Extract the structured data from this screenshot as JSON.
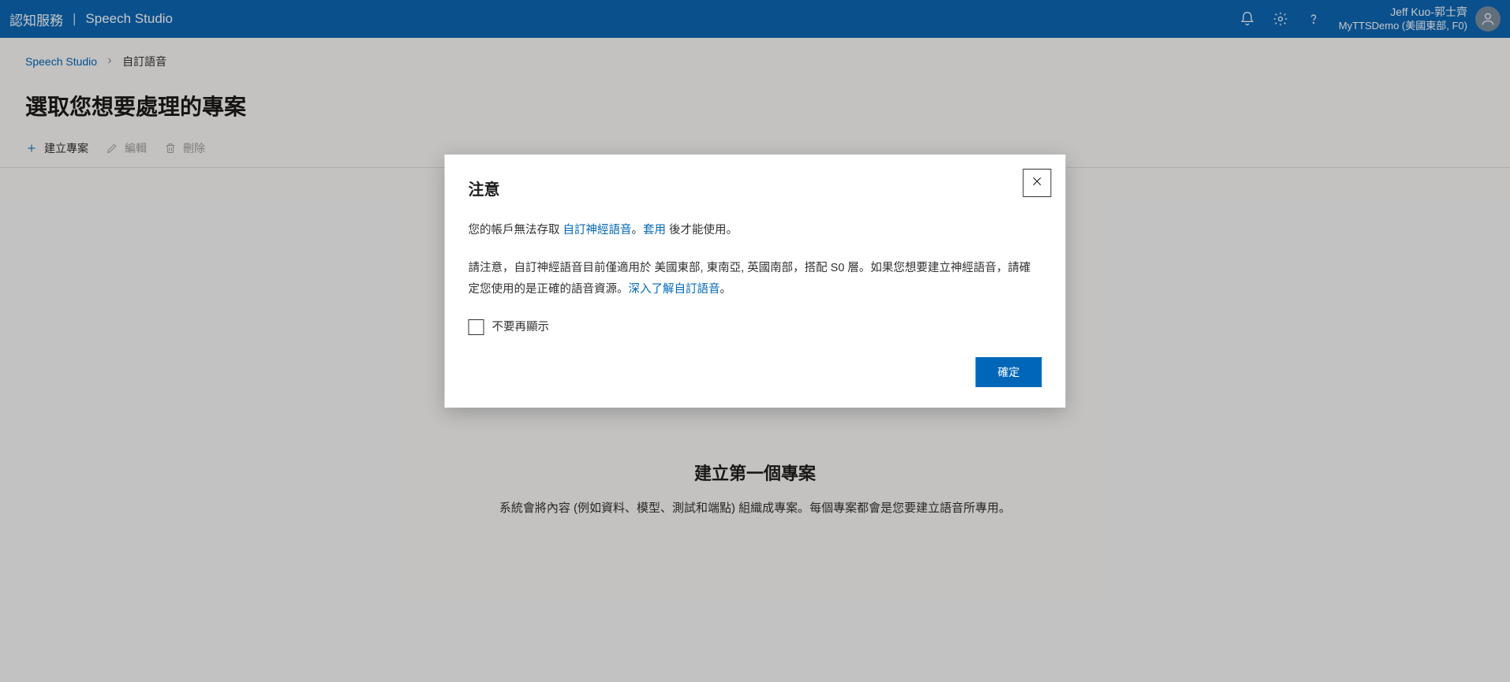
{
  "header": {
    "brand": "認知服務",
    "app_name": "Speech Studio",
    "user_name": "Jeff Kuo-郭士齊",
    "subscription": "MyTTSDemo (美國東部, F0)"
  },
  "breadcrumb": {
    "root": "Speech Studio",
    "current": "自訂語音"
  },
  "page": {
    "title": "選取您想要處理的專案"
  },
  "toolbar": {
    "create": "建立專案",
    "edit": "編輯",
    "delete": "刪除"
  },
  "empty": {
    "headline": "建立第一個專案",
    "subtext": "系統會將內容 (例如資料、模型、測試和端點) 組織成專案。每個專案都會是您要建立語音所專用。"
  },
  "modal": {
    "title": "注意",
    "p1_pre": "您的帳戶無法存取 ",
    "p1_link1": "自訂神經語音",
    "p1_mid": "。",
    "p1_link2": "套用",
    "p1_post": " 後才能使用。",
    "p2_pre": "請注意，自訂神經語音目前僅適用於 美國東部, 東南亞, 英國南部，搭配 S0 層。如果您想要建立神經語音，請確定您使用的是正確的語音資源。",
    "p2_link": "深入了解自訂語音",
    "p2_post": "。",
    "checkbox_label": "不要再顯示",
    "ok": "確定"
  }
}
